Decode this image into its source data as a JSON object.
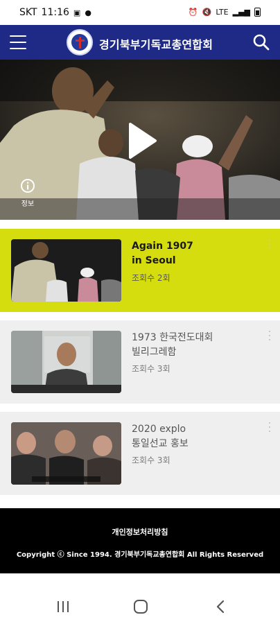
{
  "status_bar": {
    "carrier": "SKT",
    "time": "11:16",
    "network": "LTE"
  },
  "header": {
    "title": "경기북부기독교총연합회"
  },
  "hero": {
    "info_label": "정보"
  },
  "videos": [
    {
      "title_line1": "Again 1907",
      "title_line2": "in Seoul",
      "views": "조회수 2회",
      "active": true
    },
    {
      "title_line1": "1973 한국전도대회",
      "title_line2": "빌리그레함",
      "views": "조회수 3회",
      "active": false
    },
    {
      "title_line1": "2020 explo",
      "title_line2": "통일선교 홍보",
      "views": "조회수 3회",
      "active": false
    }
  ],
  "footer": {
    "privacy_link": "개인정보처리방침",
    "copyright": "Copyright ⓒ Since 1994. 경기북부기독교총연합회 All Rights Reserved"
  },
  "colors": {
    "header_bg": "#1e2a86",
    "active_item_bg": "#d6dd0f",
    "item_bg": "#efefef",
    "footer_bg": "#000000"
  },
  "icons": [
    "menu-icon",
    "logo",
    "search-icon",
    "play-icon",
    "info-icon",
    "more-vertical-icon",
    "recents-icon",
    "home-icon",
    "back-icon"
  ]
}
